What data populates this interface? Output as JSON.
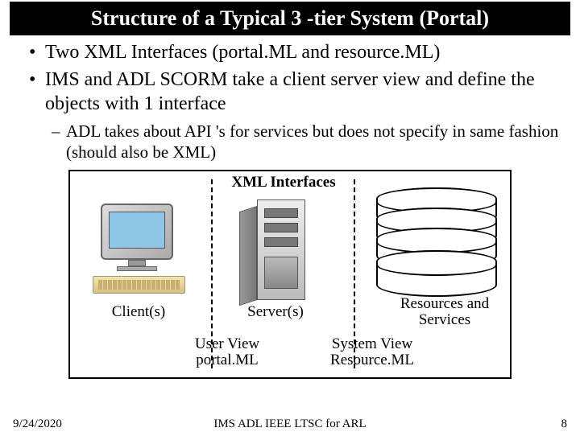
{
  "title": "Structure of a Typical 3 -tier System (Portal)",
  "bullets": {
    "b1": "Two XML Interfaces (portal.ML and resource.ML)",
    "b2": "IMS and ADL SCORM take a client server view and define the objects with 1 interface",
    "b2sub": "ADL takes about API 's for services but does not specify in same fashion (should also be XML)"
  },
  "diagram": {
    "xml_interfaces": "XML Interfaces",
    "client": "Client(s)",
    "server": "Server(s)",
    "resources": "Resources and Services",
    "user_view_l1": "User View",
    "user_view_l2": "portal.ML",
    "system_view_l1": "System View",
    "system_view_l2": "Resource.ML"
  },
  "footer": {
    "date": "9/24/2020",
    "center": "IMS ADL IEEE LTSC for ARL",
    "page": "8"
  }
}
